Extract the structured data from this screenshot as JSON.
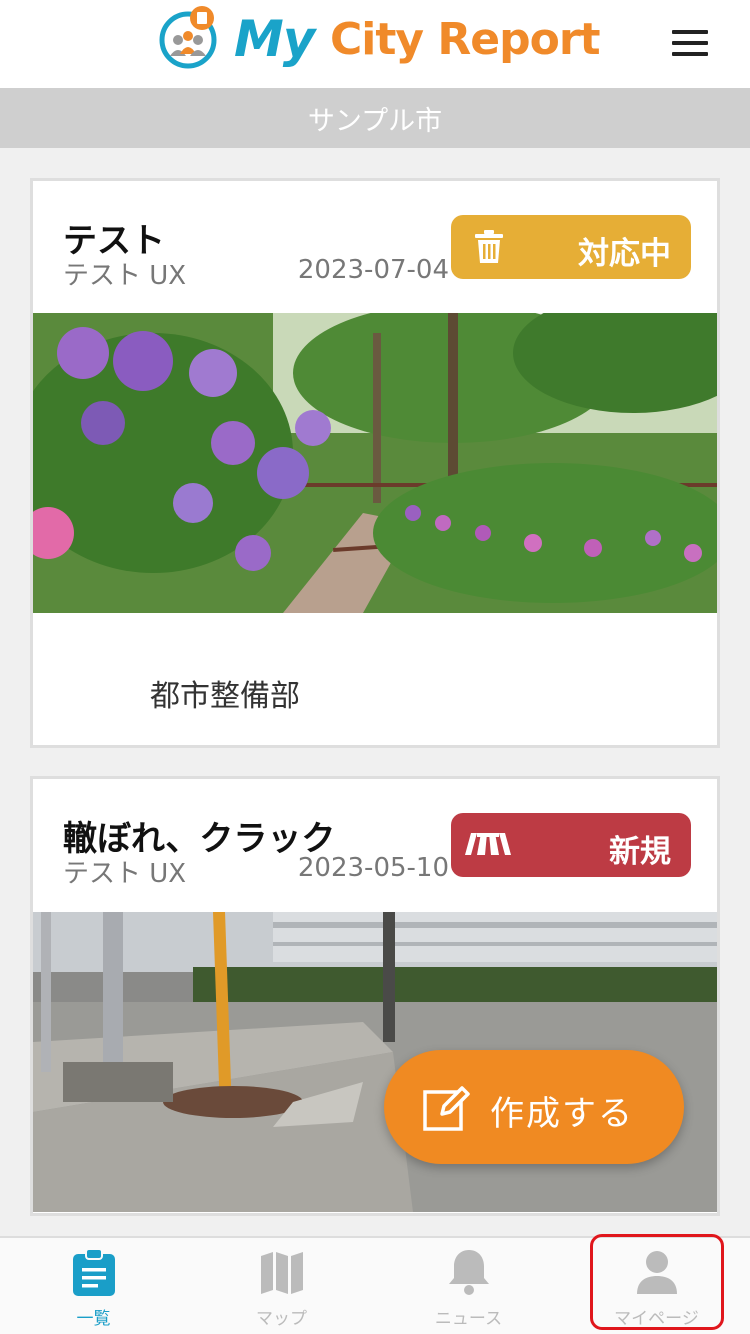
{
  "header": {
    "logo_my": "My",
    "logo_rest": "City Report",
    "menu_icon": "hamburger-menu-icon"
  },
  "city_name": "サンプル市",
  "reports": [
    {
      "title": "テスト",
      "author": "テスト UX",
      "date": "2023-07-04",
      "status": "対応中",
      "status_icon": "trash-icon",
      "status_color": "#e6ae36",
      "department": "都市整備部",
      "photo": "hydrangea-path-photo"
    },
    {
      "title": "轍ぼれ、クラック",
      "author": "テスト UX",
      "date": "2023-05-10",
      "status": "新規",
      "status_icon": "road-icon",
      "status_color": "#bd3b44",
      "photo": "road-pothole-photo"
    }
  ],
  "fab": {
    "label": "作成する",
    "icon": "edit-icon"
  },
  "bottom_nav": [
    {
      "label": "一覧",
      "icon": "clipboard-list-icon",
      "active": true
    },
    {
      "label": "マップ",
      "icon": "map-icon",
      "active": false
    },
    {
      "label": "ニュース",
      "icon": "bell-icon",
      "active": false
    },
    {
      "label": "マイページ",
      "icon": "user-icon",
      "active": false
    }
  ],
  "colors": {
    "accent": "#1a9ec8",
    "fab": "#f08a22",
    "highlight": "#e0161c"
  }
}
